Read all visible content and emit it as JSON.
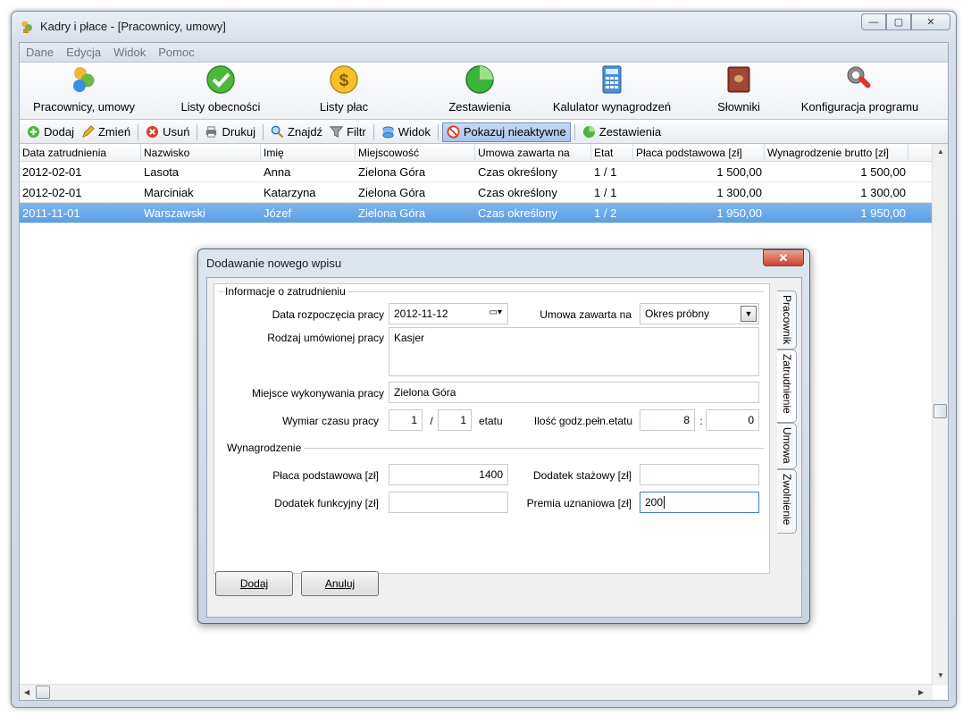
{
  "window": {
    "title": "Kadry i płace - [Pracownicy, umowy]",
    "min": "—",
    "max": "▢",
    "close": "✕"
  },
  "menu": [
    "Dane",
    "Edycja",
    "Widok",
    "Pomoc"
  ],
  "main_toolbar": [
    {
      "label": "Pracownicy, umowy",
      "icon": "people-icon"
    },
    {
      "label": "Listy obecności",
      "icon": "checkmark-icon"
    },
    {
      "label": "Listy płac",
      "icon": "dollar-coin-icon"
    },
    {
      "label": "Zestawienia",
      "icon": "pie-chart-icon"
    },
    {
      "label": "Kalulator wynagrodzeń",
      "icon": "calculator-icon"
    },
    {
      "label": "Słowniki",
      "icon": "book-icon"
    },
    {
      "label": "Konfiguracja programu",
      "icon": "wrench-icon"
    }
  ],
  "sub_toolbar": [
    {
      "label": "Dodaj",
      "icon": "plus-icon"
    },
    {
      "label": "Zmień",
      "icon": "pencil-icon"
    },
    {
      "label": "Usuń",
      "icon": "delete-icon"
    },
    {
      "label": "Drukuj",
      "icon": "printer-icon"
    },
    {
      "label": "Znajdź",
      "icon": "magnifier-icon"
    },
    {
      "label": "Filtr",
      "icon": "funnel-icon"
    },
    {
      "label": "Widok",
      "icon": "view-icon"
    },
    {
      "label": "Pokazuj nieaktywne",
      "icon": "inactive-icon"
    },
    {
      "label": "Zestawienia",
      "icon": "report-icon"
    }
  ],
  "table": {
    "columns": [
      "Data zatrudnienia",
      "Nazwisko",
      "Imię",
      "Miejscowość",
      "Umowa zawarta na",
      "Etat",
      "Płaca podstawowa [zł]",
      "Wynagrodzenie brutto [zł]"
    ],
    "rows": [
      [
        "2012-02-01",
        "Lasota",
        "Anna",
        "Zielona Góra",
        "Czas określony",
        "1 / 1",
        "1 500,00",
        "1 500,00"
      ],
      [
        "2012-02-01",
        "Marciniak",
        "Katarzyna",
        "Zielona Góra",
        "Czas określony",
        "1 / 1",
        "1 300,00",
        "1 300,00"
      ],
      [
        "2011-11-01",
        "Warszawski",
        "Józef",
        "Zielona Góra",
        "Czas określony",
        "1 / 2",
        "1 950,00",
        "1 950,00"
      ]
    ]
  },
  "dialog": {
    "title": "Dodawanie nowego wpisu",
    "close": "✕",
    "group_employment": "Informacje o zatrudnieniu",
    "start_date_label": "Data rozpoczęcia pracy",
    "start_date": "2012-11-12",
    "contract_label": "Umowa zawarta na",
    "contract": "Okres próbny",
    "job_type_label": "Rodzaj umówionej pracy",
    "job_type": "Kasjer",
    "place_label": "Miejsce wykonywania pracy",
    "place": "Zielona Góra",
    "worktime_label": "Wymiar czasu pracy",
    "worktime_num": "1",
    "slash": "/",
    "worktime_den": "1",
    "etat_suffix": "etatu",
    "hours_label": "Ilość godz.pełn.etatu",
    "hours": "8",
    "colon": ":",
    "minutes": "0",
    "group_salary": "Wynagrodzenie",
    "base_pay_label": "Płaca podstawowa [zł]",
    "base_pay": "1400",
    "seniority_label": "Dodatek stażowy [zł]",
    "seniority": "",
    "function_label": "Dodatek funkcyjny [zł]",
    "function": "",
    "bonus_label": "Premia uznaniowa [zł]",
    "bonus": "200",
    "tabs": [
      "Pracownik",
      "Zatrudnienie",
      "Umowa",
      "Zwolnienie"
    ],
    "add_button": "Dodaj",
    "cancel_button": "Anuluj"
  },
  "colors": {
    "selection": "#5a9ee5",
    "accent": "#3d7bd2",
    "close": "#c8442c"
  }
}
